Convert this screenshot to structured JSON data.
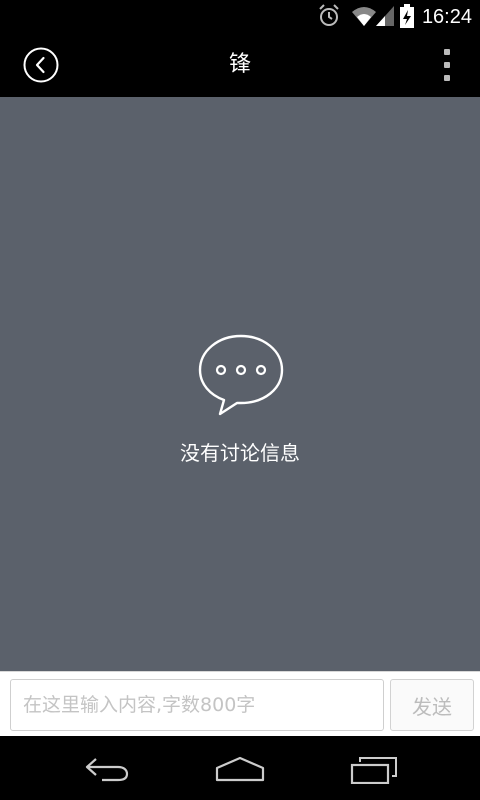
{
  "status_bar": {
    "time": "16:24",
    "icons": [
      "alarm-icon",
      "wifi-icon",
      "signal-icon",
      "battery-charging-icon"
    ]
  },
  "header": {
    "title": "锋",
    "back_icon": "back-circle-icon",
    "menu_icon": "overflow-menu-icon"
  },
  "main": {
    "empty_icon": "chat-bubble-icon",
    "empty_text": "没有讨论信息"
  },
  "composer": {
    "placeholder": "在这里输入内容,字数800字",
    "value": "",
    "send_label": "发送"
  },
  "nav_bar": {
    "buttons": [
      "back-icon",
      "home-icon",
      "recents-icon"
    ]
  },
  "colors": {
    "content_bg": "#5b616b",
    "bar_bg": "#000000",
    "composer_bg": "#ffffff"
  }
}
